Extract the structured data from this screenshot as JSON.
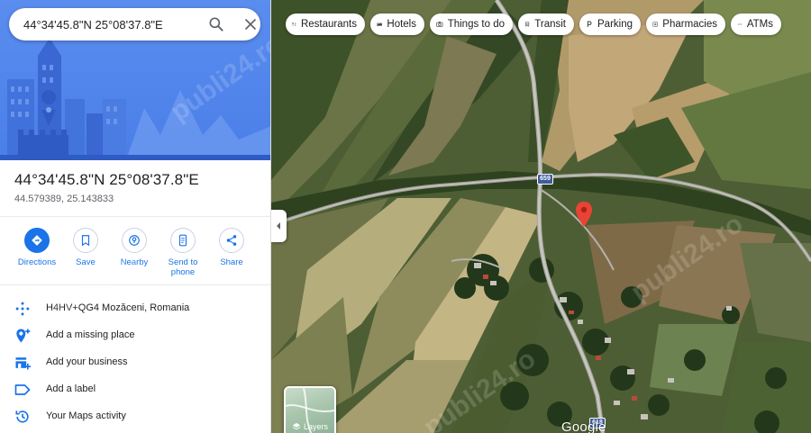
{
  "search": {
    "value": "44°34'45.8\"N 25°08'37.8\"E"
  },
  "place": {
    "title": "44°34'45.8\"N 25°08'37.8\"E",
    "coordinates": "44.579389, 25.143833"
  },
  "actions": [
    {
      "label": "Directions",
      "icon": "directions-icon"
    },
    {
      "label": "Save",
      "icon": "bookmark-icon"
    },
    {
      "label": "Nearby",
      "icon": "nearby-icon"
    },
    {
      "label": "Send to phone",
      "icon": "phone-icon"
    },
    {
      "label": "Share",
      "icon": "share-icon"
    }
  ],
  "details": [
    {
      "text": "H4HV+QG4 Mozăceni, Romania",
      "icon": "plus-code-icon"
    },
    {
      "text": "Add a missing place",
      "icon": "add-place-icon"
    },
    {
      "text": "Add your business",
      "icon": "business-icon"
    },
    {
      "text": "Add a label",
      "icon": "label-icon"
    },
    {
      "text": "Your Maps activity",
      "icon": "history-icon"
    }
  ],
  "chips": [
    {
      "label": "Restaurants",
      "icon": "restaurant-icon"
    },
    {
      "label": "Hotels",
      "icon": "hotel-icon"
    },
    {
      "label": "Things to do",
      "icon": "camera-icon"
    },
    {
      "label": "Transit",
      "icon": "transit-icon"
    },
    {
      "label": "Parking",
      "icon": "parking-icon"
    },
    {
      "label": "Pharmacies",
      "icon": "pharmacy-icon"
    },
    {
      "label": "ATMs",
      "icon": "more-icon"
    }
  ],
  "map": {
    "layers_label": "Layers",
    "road_label_1": "659",
    "road_label_2": "618",
    "logo": "Google",
    "watermark": "publi24.ro"
  },
  "colors": {
    "accent": "#1a73e8",
    "pin": "#ea4335",
    "hero": "#5b8def"
  }
}
